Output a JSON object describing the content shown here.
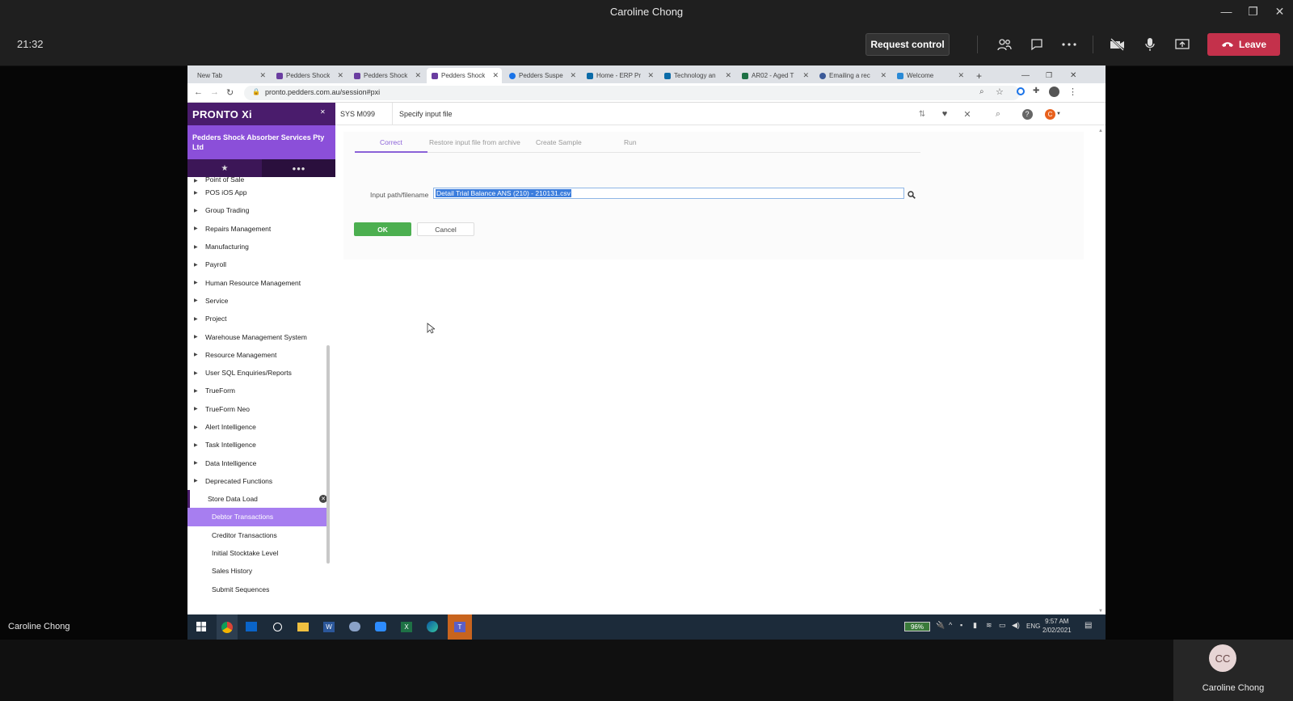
{
  "teams": {
    "window_title": "Caroline Chong",
    "clock": "21:32",
    "request_control": "Request control",
    "leave": "Leave",
    "presenter": "Caroline Chong",
    "participant": {
      "initials": "CC",
      "name": "Caroline Chong"
    },
    "icons": [
      "people-icon",
      "chat-icon",
      "more-icon",
      "camera-off-icon",
      "mic-icon",
      "share-icon",
      "phone-icon"
    ]
  },
  "browser": {
    "tabs": [
      {
        "label": "New Tab"
      },
      {
        "label": "Pedders Shock"
      },
      {
        "label": "Pedders Shock"
      },
      {
        "label": "Pedders Shock"
      },
      {
        "label": "Pedders Suspe"
      },
      {
        "label": "Home - ERP Pr"
      },
      {
        "label": "Technology an"
      },
      {
        "label": "AR02 - Aged T"
      },
      {
        "label": "Emailing a rec"
      },
      {
        "label": "Welcome"
      }
    ],
    "url": "pronto.pedders.com.au/session#pxi"
  },
  "sidebar": {
    "logo": "PRONTO Xi",
    "company": "Pedders Shock Absorber Services Pty Ltd",
    "menu": [
      "Point of Sale",
      "POS iOS App",
      "Group Trading",
      "Repairs Management",
      "Manufacturing",
      "Payroll",
      "Human Resource Management",
      "Service",
      "Project",
      "Warehouse Management System",
      "Resource Management",
      "User SQL Enquiries/Reports",
      "TrueForm",
      "TrueForm Neo",
      "Alert Intelligence",
      "Task Intelligence",
      "Data Intelligence",
      "Deprecated Functions"
    ],
    "store_data_load": "Store Data Load",
    "submenu": [
      "Debtor Transactions",
      "Creditor Transactions",
      "Initial Stocktake Level",
      "Sales History",
      "Submit Sequences"
    ],
    "selected": "Debtor Transactions"
  },
  "main": {
    "program_code": "SYS M099",
    "program_title": "Specify input file",
    "tabs": [
      "Correct",
      "Restore input file from archive",
      "Create Sample",
      "Run"
    ],
    "input_label": "Input path/filename",
    "input_value": "Detail Trial Balance ANS (210) - 210131.csv",
    "ok": "OK",
    "cancel": "Cancel"
  },
  "taskbar": {
    "battery": "96%",
    "lang": "ENG",
    "time": "9:57 AM",
    "date": "2/02/2021"
  }
}
